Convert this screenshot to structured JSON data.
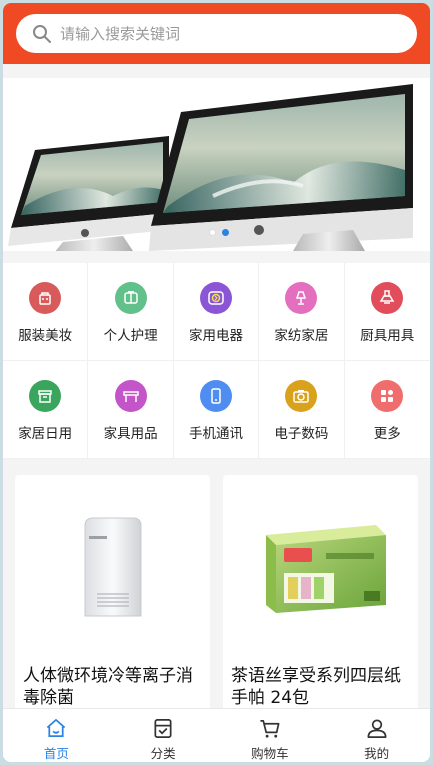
{
  "search": {
    "placeholder": "请输入搜索关键词"
  },
  "banner": {
    "slide_count": 2,
    "active_slide": 2
  },
  "categories": [
    {
      "label": "服装美妆",
      "icon": "clothing-icon",
      "color": "#d95a5a"
    },
    {
      "label": "个人护理",
      "icon": "personal-care-icon",
      "color": "#62c08b"
    },
    {
      "label": "家用电器",
      "icon": "appliance-icon",
      "color": "#8b56d6"
    },
    {
      "label": "家纺家居",
      "icon": "lamp-icon",
      "color": "#e46fbf"
    },
    {
      "label": "厨具用具",
      "icon": "range-hood-icon",
      "color": "#e24d5c"
    },
    {
      "label": "家居日用",
      "icon": "storage-box-icon",
      "color": "#3aa55c"
    },
    {
      "label": "家具用品",
      "icon": "table-icon",
      "color": "#c455c9"
    },
    {
      "label": "手机通讯",
      "icon": "phone-icon",
      "color": "#4f8ef0"
    },
    {
      "label": "电子数码",
      "icon": "camera-icon",
      "color": "#d9a21c"
    },
    {
      "label": "更多",
      "icon": "more-grid-icon",
      "color": "#f06d6d"
    }
  ],
  "products": [
    {
      "title": "人体微环境冷等离子消毒除菌"
    },
    {
      "title": "茶语丝享受系列四层纸手帕 24包"
    }
  ],
  "tabbar": [
    {
      "label": "首页",
      "icon": "home-icon",
      "active": true
    },
    {
      "label": "分类",
      "icon": "category-icon",
      "active": false
    },
    {
      "label": "购物车",
      "icon": "cart-icon",
      "active": false
    },
    {
      "label": "我的",
      "icon": "user-icon",
      "active": false
    }
  ],
  "colors": {
    "header": "#f04a24",
    "accent": "#2a82e4"
  }
}
